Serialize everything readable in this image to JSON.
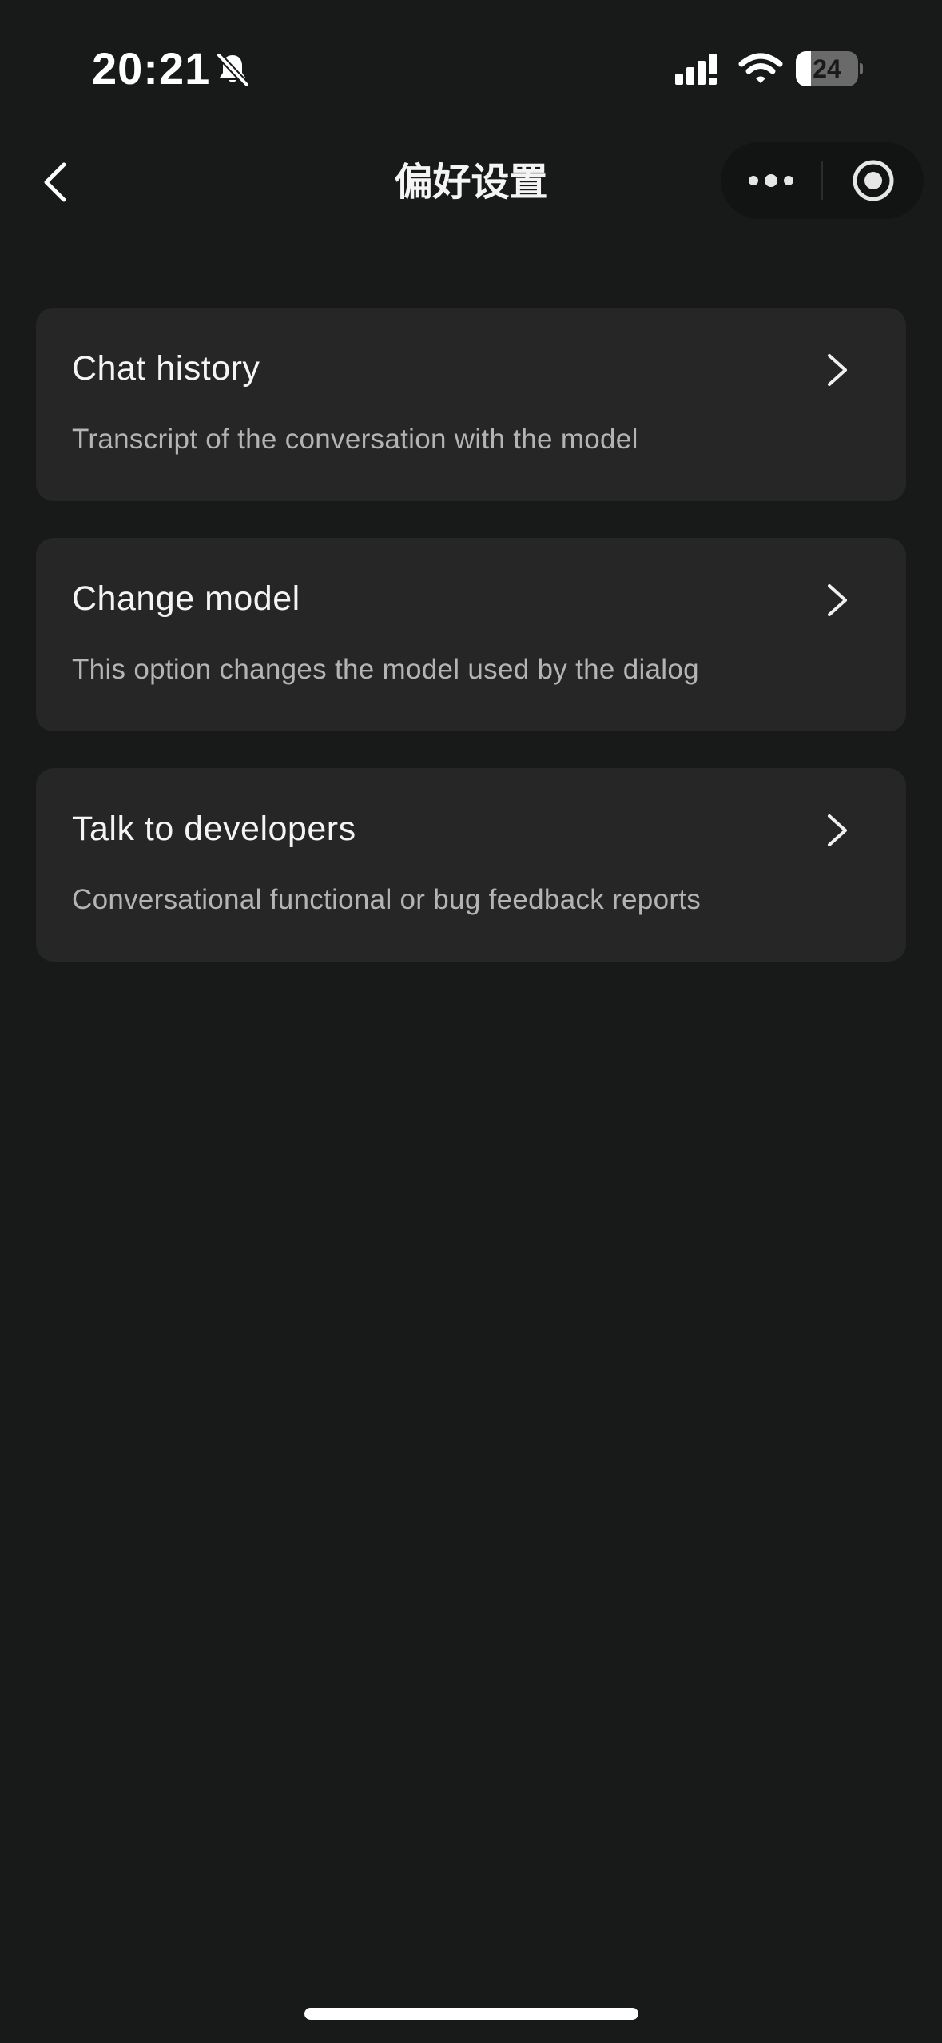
{
  "status_bar": {
    "time": "20:21",
    "battery_level": "24",
    "battery_fraction": 0.24,
    "icons": [
      "bell-slash-icon",
      "cellular-signal-icon",
      "wifi-icon",
      "battery-icon"
    ]
  },
  "nav": {
    "title": "偏好设置",
    "back_icon": "chevron-left-icon",
    "more_icon": "more-dots-icon",
    "close_icon": "target-circle-icon"
  },
  "menu": {
    "items": [
      {
        "title": "Chat history",
        "description": "Transcript of the conversation with the model",
        "icon": "chevron-right-icon"
      },
      {
        "title": "Change model",
        "description": "This option changes the model used by the dialog",
        "icon": "chevron-right-icon"
      },
      {
        "title": "Talk to developers",
        "description": "Conversational functional or bug feedback reports",
        "icon": "chevron-right-icon"
      }
    ]
  },
  "colors": {
    "background": "#181919",
    "card": "#262627",
    "title_text": "#f4f4f4",
    "description_text": "#b4b4b4",
    "capsule": "#121313"
  }
}
